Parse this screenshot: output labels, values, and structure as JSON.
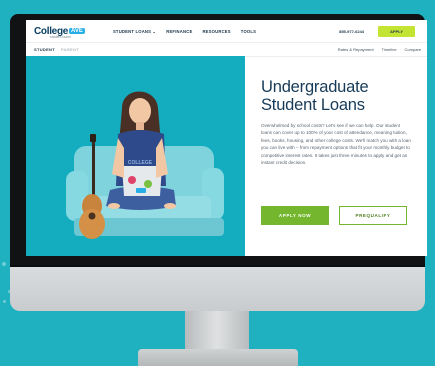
{
  "colors": {
    "background": "#1fb1bf",
    "hero_teal": "#14adc0",
    "accent_green": "#74b72e",
    "nav_apply_lime": "#c4e433",
    "headline_navy": "#163a57"
  },
  "site": {
    "logo": {
      "text": "College",
      "mark": "AVE",
      "sub": "student loans"
    },
    "nav": {
      "items": [
        "STUDENT LOANS ⌄",
        "REFINANCE",
        "RESOURCES",
        "TOOLS"
      ],
      "phone": "855-977-6244",
      "apply_label": "APPLY"
    },
    "subnav": {
      "tabs": [
        "STUDENT",
        "PARENT"
      ],
      "links": [
        "Rates & Repayment",
        "Timeline",
        "Compare"
      ]
    },
    "hero": {
      "headline_line1": "Undergraduate",
      "headline_line2": "Student Loans",
      "body": "Overwhelmed by school costs? Let's see if we can help. Our student loans can cover up to 100% of your cost of attendance, meaning tuition, fees, books, housing, and other college costs. We'll match you with a loan you can live with – from repayment options that fit your monthly budget to competitive interest rates. It takes just three minutes to apply and get an instant credit decision.",
      "apply_button": "APPLY NOW",
      "prequalify_button": "PREQUALIFY"
    },
    "illustration": {
      "shirt_text": "COLLEGE",
      "laptop_sticker": "AVE"
    }
  }
}
